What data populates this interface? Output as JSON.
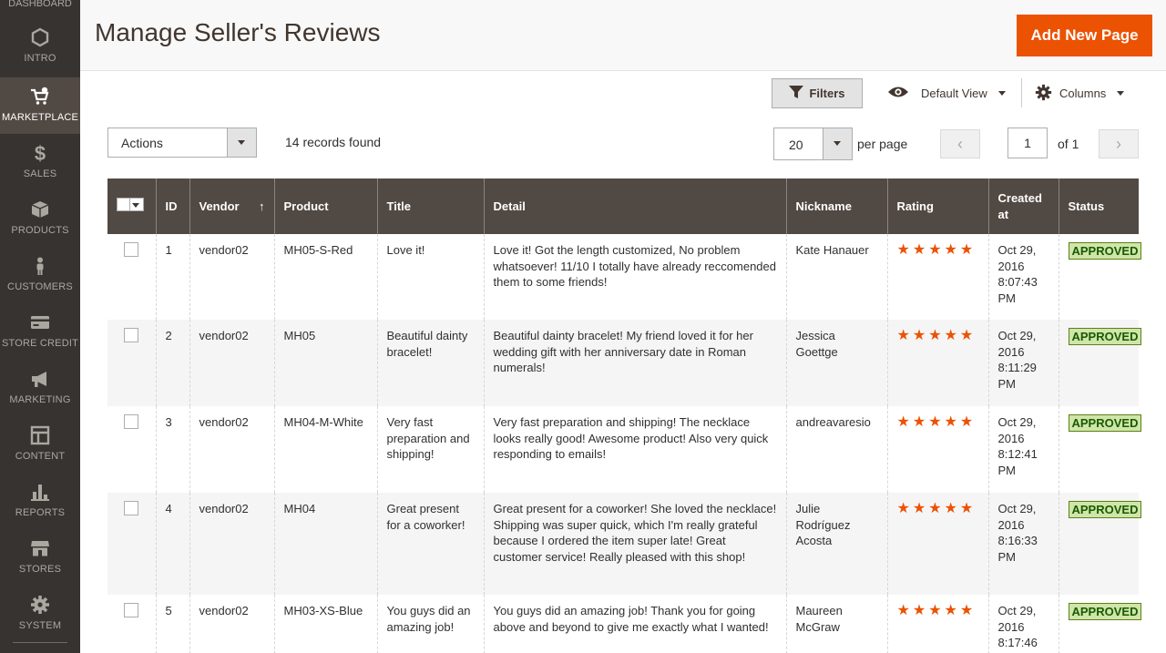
{
  "sidebar": {
    "top_label": "DASHBOARD",
    "items": [
      {
        "label": "INTRO",
        "icon": "hexagon-icon"
      },
      {
        "label": "MARKETPLACE",
        "icon": "cart-icon",
        "active": true
      },
      {
        "label": "SALES",
        "icon": "dollar-icon"
      },
      {
        "label": "PRODUCTS",
        "icon": "box-icon"
      },
      {
        "label": "CUSTOMERS",
        "icon": "person-icon"
      },
      {
        "label": "STORE CREDIT",
        "icon": "credit-card-icon"
      },
      {
        "label": "MARKETING",
        "icon": "megaphone-icon"
      },
      {
        "label": "CONTENT",
        "icon": "layout-icon"
      },
      {
        "label": "REPORTS",
        "icon": "bar-chart-icon"
      },
      {
        "label": "STORES",
        "icon": "store-icon"
      },
      {
        "label": "SYSTEM",
        "icon": "gear-icon"
      }
    ]
  },
  "header": {
    "title": "Manage Seller's Reviews",
    "add_button": "Add New Page"
  },
  "toolbar": {
    "filters": "Filters",
    "default_view": "Default View",
    "columns": "Columns",
    "actions": "Actions",
    "records": "14 records found",
    "per_page_value": "20",
    "per_page_label": "per page",
    "page_value": "1",
    "page_of": "of 1"
  },
  "grid": {
    "columns": [
      "ID",
      "Vendor",
      "Product",
      "Title",
      "Detail",
      "Nickname",
      "Rating",
      "Created at",
      "Status"
    ],
    "rows": [
      {
        "id": "1",
        "vendor": "vendor02",
        "product": "MH05-S-Red",
        "title": "Love it!",
        "detail": "Love it! Got the length customized, No problem whatsoever! 11/10 I totally have already reccomended them to some friends!",
        "nickname": "Kate Hanauer",
        "rating": 5,
        "created": "Oct 29, 2016 8:07:43 PM",
        "status": "APPROVED"
      },
      {
        "id": "2",
        "vendor": "vendor02",
        "product": "MH05",
        "title": "Beautiful dainty bracelet!",
        "detail": "Beautiful dainty bracelet! My friend loved it for her wedding gift with her anniversary date in Roman numerals!",
        "nickname": "Jessica Goettge",
        "rating": 5,
        "created": "Oct 29, 2016 8:11:29 PM",
        "status": "APPROVED"
      },
      {
        "id": "3",
        "vendor": "vendor02",
        "product": "MH04-M-White",
        "title": "Very fast preparation and shipping!",
        "detail": "Very fast preparation and shipping! The necklace looks really good! Awesome product! Also very quick responding to emails!",
        "nickname": "andreavaresio",
        "rating": 5,
        "created": "Oct 29, 2016 8:12:41 PM",
        "status": "APPROVED"
      },
      {
        "id": "4",
        "vendor": "vendor02",
        "product": "MH04",
        "title": "Great present for a coworker!",
        "detail": "Great present for a coworker! She loved the necklace! Shipping was super quick, which I'm really grateful because I ordered the item super late! Great customer service! Really pleased with this shop!",
        "nickname": "Julie Rodríguez Acosta",
        "rating": 5,
        "created": "Oct 29, 2016 8:16:33 PM",
        "status": "APPROVED"
      },
      {
        "id": "5",
        "vendor": "vendor02",
        "product": "MH03-XS-Blue",
        "title": "You guys did an amazing job!",
        "detail": "You guys did an amazing job! Thank you for going above and beyond to give me exactly what I wanted!",
        "nickname": "Maureen McGraw",
        "rating": 5,
        "created": "Oct 29, 2016 8:17:46",
        "status": "APPROVED"
      }
    ]
  },
  "colors": {
    "sidebar_bg": "#373330",
    "accent": "#eb5202",
    "grid_header": "#514943",
    "approved_bg": "#d0e5a9"
  }
}
